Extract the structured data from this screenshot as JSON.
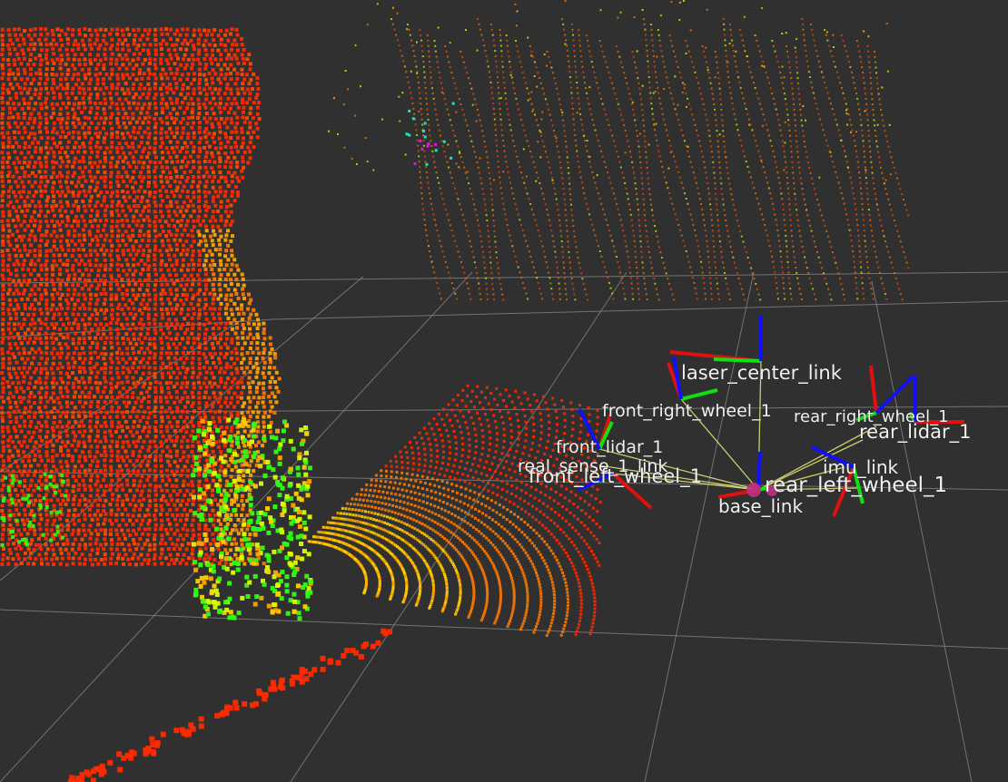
{
  "viewer": {
    "background": "#303030",
    "grid_color": "#8a8a8a",
    "link_line_color": "#e8e87a"
  },
  "frames": [
    {
      "name": "laser_center_link",
      "label": "laser_center_link"
    },
    {
      "name": "front_right_wheel_1",
      "label": "front_right_wheel_1"
    },
    {
      "name": "front_lidar_1",
      "label": "front_lidar_1"
    },
    {
      "name": "real_sense_1_link",
      "label": "real_sense_1_link"
    },
    {
      "name": "front_left_wheel_1",
      "label": "front_left_wheel_1"
    },
    {
      "name": "base_link",
      "label": "base_link"
    },
    {
      "name": "rear_right_wheel_1",
      "label": "rear_right_wheel_1"
    },
    {
      "name": "rear_lidar_1",
      "label": "rear_lidar_1"
    },
    {
      "name": "imu_link",
      "label": "imu_link"
    },
    {
      "name": "rear_left_wheel_1",
      "label": "rear_left_wheel_1"
    }
  ],
  "axis_colors": {
    "x": "#e01010",
    "y": "#10e010",
    "z": "#1010ff"
  },
  "pointcloud_colors": [
    "#ff2a00",
    "#ff4a00",
    "#ff7a00",
    "#ffa400",
    "#ffd000",
    "#d8ff00",
    "#30ff10",
    "#10ffd0",
    "#ff10ff"
  ]
}
